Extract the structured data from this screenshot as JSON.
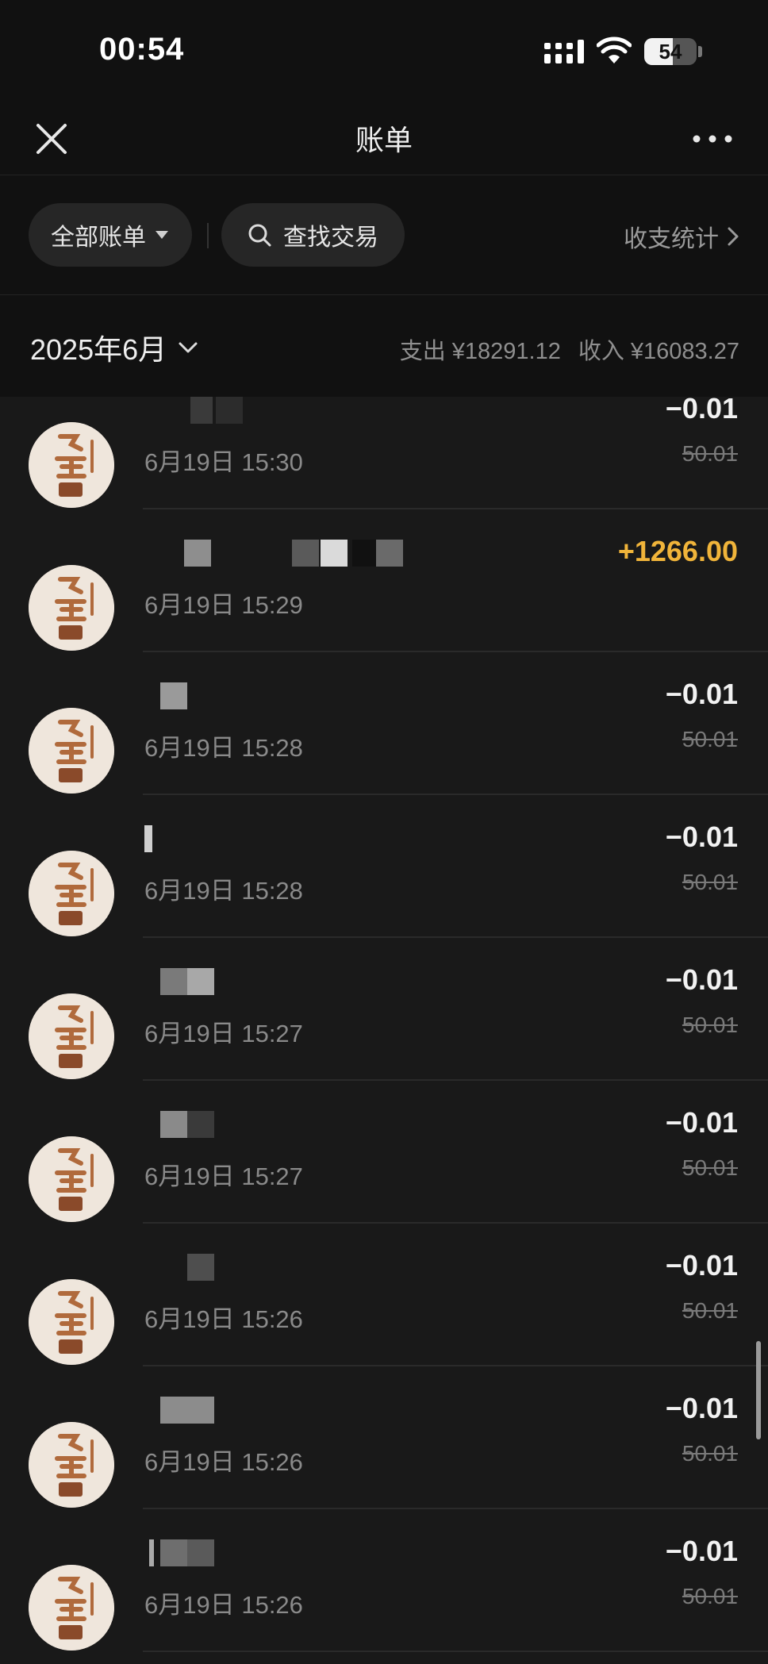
{
  "status_bar": {
    "time": "00:54",
    "battery": "54",
    "battery_level": 0.54
  },
  "nav": {
    "title": "账单",
    "close_icon": "close-icon",
    "more_icon": "more-dots-icon"
  },
  "filters": {
    "all_bills": "全部账单",
    "search": "查找交易",
    "stats": "收支统计"
  },
  "month_header": {
    "month": "2025年6月",
    "expense": "支出 ¥18291.12",
    "income": "收入 ¥16083.27"
  },
  "transactions": [
    {
      "title": "",
      "time": "6月19日 15:30",
      "amount": "−0.01",
      "original": "50.01"
    },
    {
      "title": "",
      "time": "6月19日 15:29",
      "amount": "+1266.00",
      "original": ""
    },
    {
      "title": "",
      "time": "6月19日 15:28",
      "amount": "−0.01",
      "original": "50.01"
    },
    {
      "title": "",
      "time": "6月19日 15:28",
      "amount": "−0.01",
      "original": "50.01"
    },
    {
      "title": "",
      "time": "6月19日 15:27",
      "amount": "−0.01",
      "original": "50.01"
    },
    {
      "title": "",
      "time": "6月19日 15:27",
      "amount": "−0.01",
      "original": "50.01"
    },
    {
      "title": "",
      "time": "6月19日 15:26",
      "amount": "−0.01",
      "original": "50.01"
    },
    {
      "title": "",
      "time": "6月19日 15:26",
      "amount": "−0.01",
      "original": "50.01"
    },
    {
      "title": "",
      "time": "6月19日 15:26",
      "amount": "−0.01",
      "original": "50.01"
    }
  ],
  "colors": {
    "income": "#f0b43a",
    "background": "#191919",
    "header": "#111111"
  }
}
